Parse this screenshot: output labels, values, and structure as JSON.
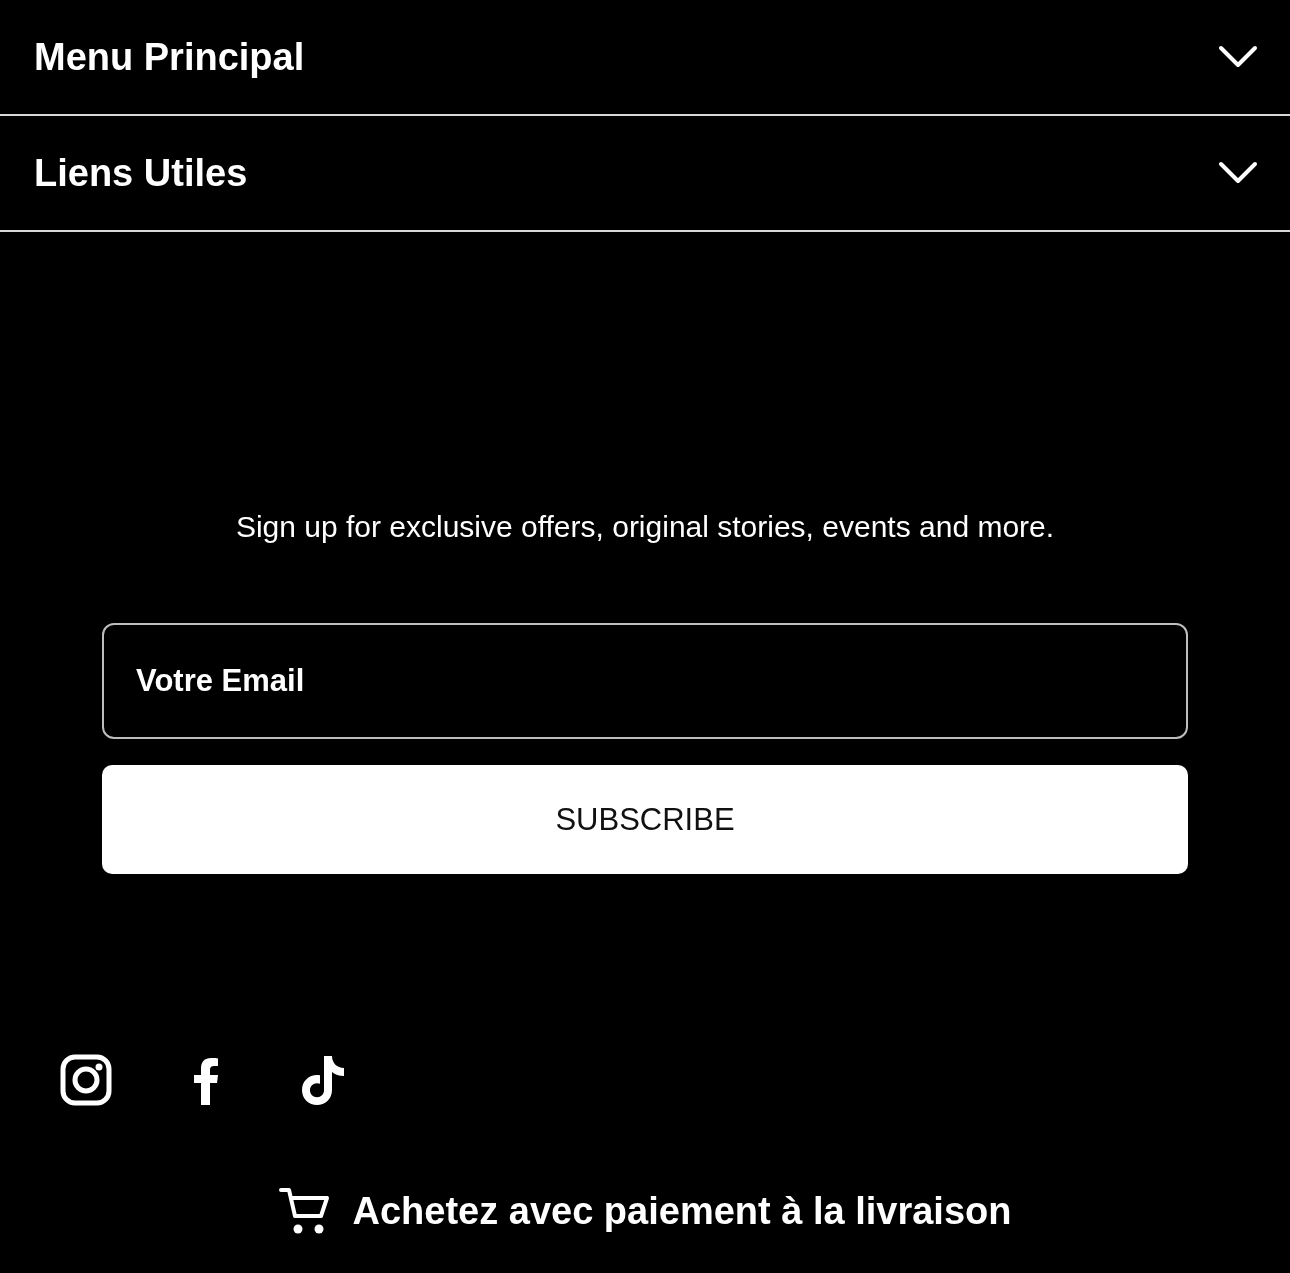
{
  "accordions": [
    {
      "label": "Menu Principal",
      "expanded": false
    },
    {
      "label": "Liens Utiles",
      "expanded": false
    }
  ],
  "newsletter": {
    "text": "Sign up for exclusive offers, original stories, events and more.",
    "email": {
      "placeholder": "Votre Email"
    },
    "button": "SUBSCRIBE"
  },
  "social": [
    {
      "kind": "instagram"
    },
    {
      "kind": "facebook"
    },
    {
      "kind": "tiktok"
    }
  ],
  "banner": {
    "text": "Achetez avec paiement à la livraison"
  }
}
